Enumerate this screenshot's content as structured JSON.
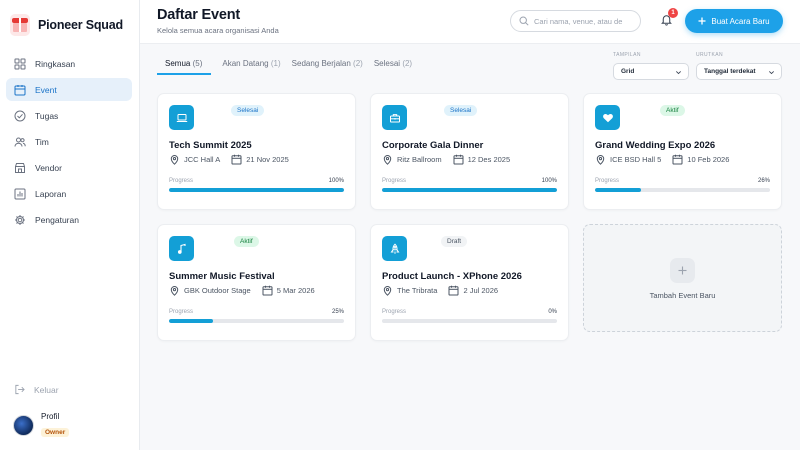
{
  "brand": {
    "name": "Pioneer Squad"
  },
  "nav": {
    "items": [
      {
        "label": "Ringkasan",
        "icon": "grid-icon"
      },
      {
        "label": "Event",
        "icon": "calendar-icon",
        "active": true
      },
      {
        "label": "Tugas",
        "icon": "check-circle-icon"
      },
      {
        "label": "Tim",
        "icon": "users-icon"
      },
      {
        "label": "Vendor",
        "icon": "store-icon"
      },
      {
        "label": "Laporan",
        "icon": "bar-chart-icon"
      },
      {
        "label": "Pengaturan",
        "icon": "gear-icon"
      }
    ],
    "logout_label": "Keluar"
  },
  "profile": {
    "name": "Profil",
    "role": "Owner"
  },
  "header": {
    "title": "Daftar Event",
    "subtitle": "Kelola semua acara organisasi Anda",
    "search_placeholder": "Cari nama, venue, atau de",
    "notification_count": "1",
    "create_label": "Buat Acara Baru"
  },
  "tabs": [
    {
      "label": "Semua",
      "count": "(5)",
      "active": true
    },
    {
      "label": "Akan Datang",
      "count": "(1)"
    },
    {
      "label": "Sedang Berjalan",
      "count": "(2)"
    },
    {
      "label": "Selesai",
      "count": "(2)"
    }
  ],
  "controls": {
    "view_label": "TAMPILAN",
    "view_value": "Grid",
    "sort_label": "URUTKAN",
    "sort_value": "Tanggal terdekat"
  },
  "progress_label": "Progress",
  "events": [
    {
      "title": "Tech Summit 2025",
      "venue": "JCC Hall A",
      "date": "21 Nov 2025",
      "status": "Selesai",
      "progress": 100,
      "progress_text": "100%",
      "icon": "laptop-icon"
    },
    {
      "title": "Corporate Gala Dinner",
      "venue": "Ritz Ballroom",
      "date": "12 Des 2025",
      "status": "Selesai",
      "progress": 100,
      "progress_text": "100%",
      "icon": "briefcase-icon"
    },
    {
      "title": "Grand Wedding Expo 2026",
      "venue": "ICE BSD Hall 5",
      "date": "10 Feb 2026",
      "status": "Aktif",
      "progress": 26,
      "progress_text": "26%",
      "icon": "heart-icon"
    },
    {
      "title": "Summer Music Festival",
      "venue": "GBK Outdoor Stage",
      "date": "5 Mar 2026",
      "status": "Aktif",
      "progress": 25,
      "progress_text": "25%",
      "icon": "music-note-icon"
    },
    {
      "title": "Product Launch - XPhone 2026",
      "venue": "The Tribrata",
      "date": "2 Jul 2026",
      "status": "Draft",
      "progress": 0,
      "progress_text": "0%",
      "icon": "rocket-icon"
    }
  ],
  "add_event_label": "Tambah Event Baru",
  "colors": {
    "accent": "#1da1e8",
    "icon_bg": "#139fd6",
    "active_nav_bg": "#e6f0fa"
  }
}
